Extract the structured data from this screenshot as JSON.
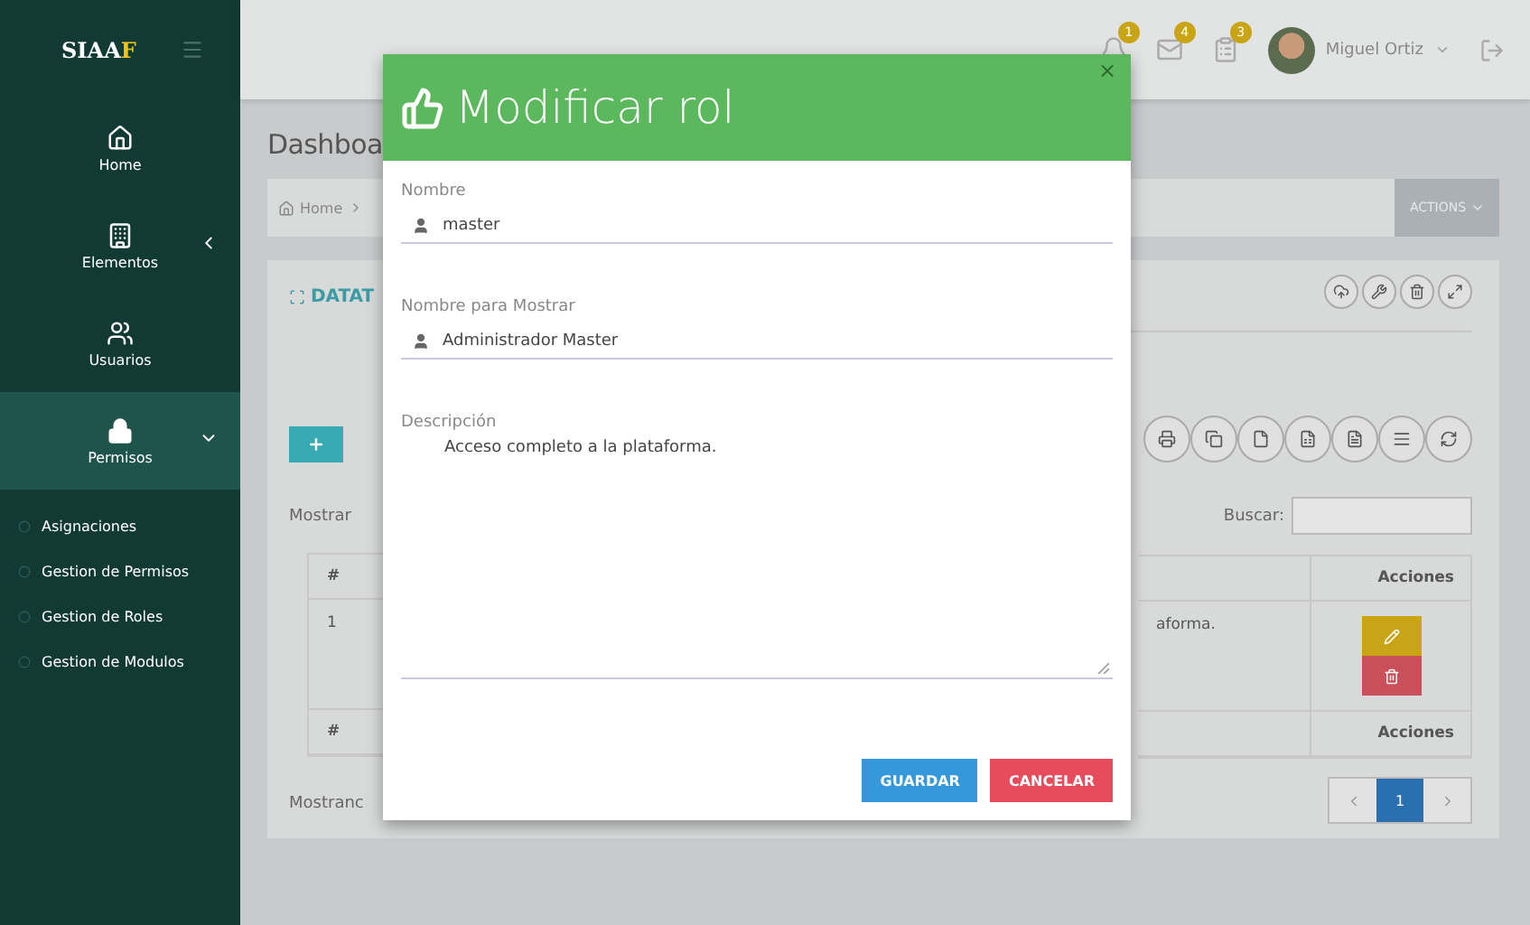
{
  "sidebar": {
    "logo": {
      "text": "SIAA",
      "accent": "F"
    },
    "items": [
      {
        "label": "Home",
        "selected": false
      },
      {
        "label": "Elementos",
        "selected": false,
        "expanded": false
      },
      {
        "label": "Usuarios",
        "selected": false
      },
      {
        "label": "Permisos",
        "selected": true,
        "expanded": true,
        "children": [
          {
            "label": "Asignaciones"
          },
          {
            "label": "Gestion de Permisos"
          },
          {
            "label": "Gestion de Roles"
          },
          {
            "label": "Gestion de Modulos"
          }
        ]
      }
    ]
  },
  "topbar": {
    "notifications": [
      {
        "count": "1"
      },
      {
        "count": "4"
      },
      {
        "count": "3"
      }
    ],
    "user": "Miguel Ortiz"
  },
  "page": {
    "title": "Dashboa",
    "breadcrumb": "Home",
    "actions": "ACTIONS"
  },
  "panel": {
    "title": "DATAT",
    "show_label": "Mostrar",
    "search_label": "Buscar:",
    "info": "Mostranc",
    "table": {
      "left_header": "#",
      "left_cell": "1",
      "left_footer": "#",
      "right_header": "Acciones",
      "right_cell": "aforma.",
      "right_footer": "Acciones"
    },
    "pages": [
      {
        "label": "1",
        "selected": true
      }
    ]
  },
  "modal": {
    "title": "Modificar rol",
    "close": "×",
    "fields": [
      {
        "label": "Nombre",
        "value": "master"
      },
      {
        "label": "Nombre para Mostrar",
        "value": "Administrador Master"
      }
    ],
    "description": {
      "label": "Descripción",
      "value": "Acceso completo a la plataforma."
    },
    "buttons": [
      {
        "label": "GUARDAR",
        "kind": "primary"
      },
      {
        "label": "CANCELAR",
        "kind": "danger"
      }
    ]
  }
}
